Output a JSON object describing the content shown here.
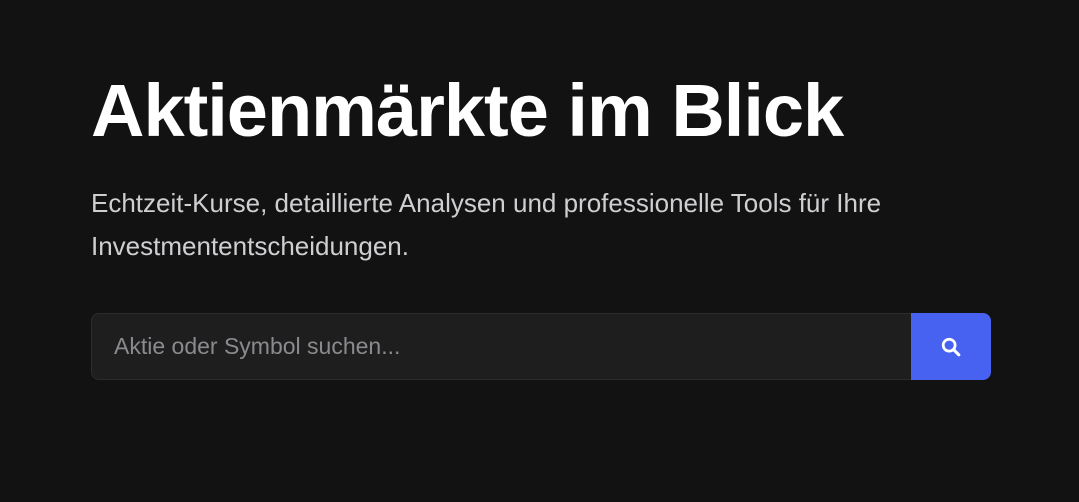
{
  "hero": {
    "title": "Aktienmärkte im Blick",
    "subtitle": "Echtzeit-Kurse, detaillierte Analysen und professionelle Tools für Ihre Investmententscheidungen."
  },
  "search": {
    "placeholder": "Aktie oder Symbol suchen...",
    "value": "",
    "button_icon": "search-icon"
  },
  "colors": {
    "background": "#121213",
    "accent": "#4761f1",
    "input_background": "#1e1e1f",
    "title": "#ffffff",
    "subtitle": "#cfcfd2"
  }
}
